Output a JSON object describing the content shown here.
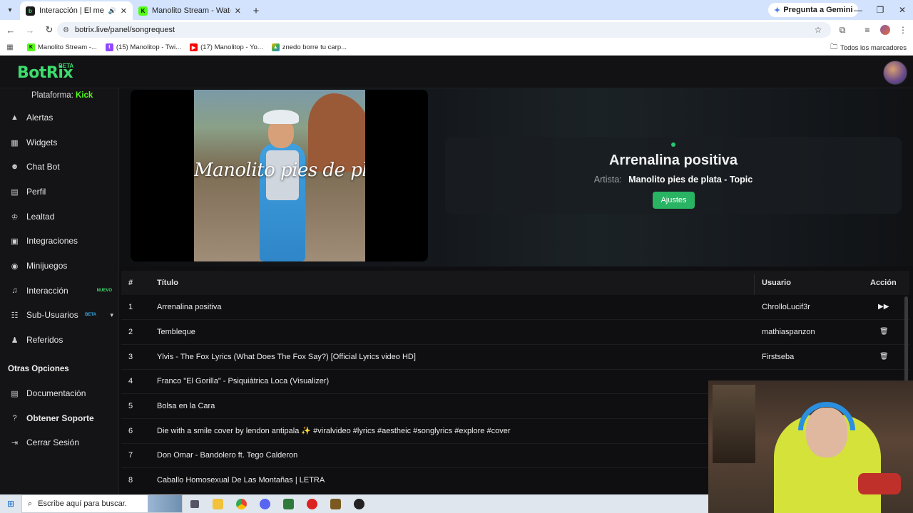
{
  "browser": {
    "tabs": [
      {
        "title": "Interacción | El mejor softw",
        "favicon": "botrix-icon",
        "active": true
      },
      {
        "title": "Manolito Stream - Watch Live o",
        "favicon": "kick-icon",
        "active": false
      }
    ],
    "gemini_label": "Pregunta a Gemini",
    "url": "botrix.live/panel/songrequest",
    "bookmarks": [
      {
        "label": "Manolito Stream -...",
        "icon": "kick-icon"
      },
      {
        "label": "(15) Manolitop - Twi...",
        "icon": "twitch-icon"
      },
      {
        "label": "(17) Manolitop - Yo...",
        "icon": "youtube-icon"
      },
      {
        "label": "znedo borre tu carp...",
        "icon": "drive-icon"
      }
    ],
    "bookmarks_all_label": "Todos los marcadores"
  },
  "app": {
    "logo": "BotRix",
    "logo_badge": "BETA",
    "platform_label": "Plataforma:",
    "platform_value": "Kick"
  },
  "sidebar": {
    "items": [
      {
        "label": "Alertas",
        "icon": "warning-icon"
      },
      {
        "label": "Widgets",
        "icon": "grid-icon"
      },
      {
        "label": "Chat Bot",
        "icon": "robot-icon"
      },
      {
        "label": "Perfil",
        "icon": "id-card-icon"
      },
      {
        "label": "Lealtad",
        "icon": "trophy-icon"
      },
      {
        "label": "Integraciones",
        "icon": "server-icon"
      },
      {
        "label": "Minijuegos",
        "icon": "gamepad-icon"
      },
      {
        "label": "Interacción",
        "icon": "music-icon",
        "tag": "NUEVO"
      },
      {
        "label": "Sub-Usuarios",
        "icon": "users-icon",
        "tag": "BETA"
      },
      {
        "label": "Referidos",
        "icon": "user-group-icon"
      }
    ],
    "other_title": "Otras Opciones",
    "other_items": [
      {
        "label": "Documentación",
        "icon": "document-icon"
      },
      {
        "label": "Obtener Soporte",
        "icon": "question-icon"
      },
      {
        "label": "Cerrar Sesión",
        "icon": "logout-icon"
      }
    ]
  },
  "player": {
    "video_overlay_text": "Manolito pies de plata",
    "now_playing_title": "Arrenalina positiva",
    "artist_label": "Artista:",
    "artist_name": "Manolito pies de plata - Topic",
    "settings_button": "Ajustes"
  },
  "queue": {
    "headers": {
      "num": "#",
      "title": "Título",
      "user": "Usuario",
      "action": "Acción"
    },
    "rows": [
      {
        "num": "1",
        "title": "Arrenalina positiva",
        "user": "ChrolloLucif3r",
        "action": "skip-icon"
      },
      {
        "num": "2",
        "title": "Tembleque",
        "user": "mathiaspanzon",
        "action": "trash-icon"
      },
      {
        "num": "3",
        "title": "Ylvis - The Fox Lyrics (What Does The Fox Say?) [Official Lyrics video HD]",
        "user": "Firstseba",
        "action": "trash-icon"
      },
      {
        "num": "4",
        "title": "Franco \"El Gorilla\" - Psiquiátrica Loca (Visualizer)",
        "user": "",
        "action": ""
      },
      {
        "num": "5",
        "title": "Bolsa en la Cara",
        "user": "",
        "action": ""
      },
      {
        "num": "6",
        "title": "Die with a smile cover by lendon antipala ✨ #viralvideo #lyrics #aestheic #songlyrics #explore #cover",
        "user": "",
        "action": ""
      },
      {
        "num": "7",
        "title": "Don Omar - Bandolero ft. Tego Calderon",
        "user": "",
        "action": ""
      },
      {
        "num": "8",
        "title": "Caballo Homosexual De Las Montañas | LETRA",
        "user": "",
        "action": ""
      }
    ]
  },
  "taskbar": {
    "search_placeholder": "Escribe aquí para buscar."
  },
  "colors": {
    "accent_green": "#3ddc6e",
    "kick_green": "#53fc18",
    "button_green": "#28b463"
  }
}
